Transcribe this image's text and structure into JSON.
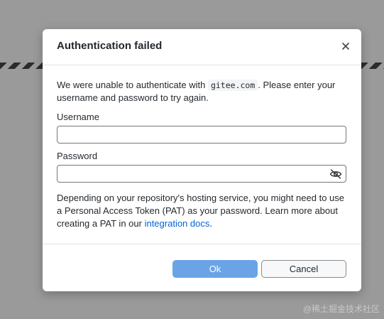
{
  "dialog": {
    "title": "Authentication failed",
    "close_icon": "close-icon",
    "intro_before": "We were unable to authenticate with ",
    "host": "gitee.com",
    "intro_after": ". Please enter your username and password to try again.",
    "username_label": "Username",
    "username_value": "",
    "password_label": "Password",
    "password_value": "",
    "password_toggle_icon": "eye-slash-icon",
    "help_before": "Depending on your repository's hosting service, you might need to use a Personal Access Token (PAT) as your password. Learn more about creating a PAT in our ",
    "help_link": "integration docs",
    "help_after": ".",
    "ok_label": "Ok",
    "cancel_label": "Cancel"
  },
  "colors": {
    "primary": "#6aa4e6",
    "link": "#0366d6",
    "backdrop": "#9a9a9a"
  },
  "watermark": "@稀土掘金技术社区"
}
